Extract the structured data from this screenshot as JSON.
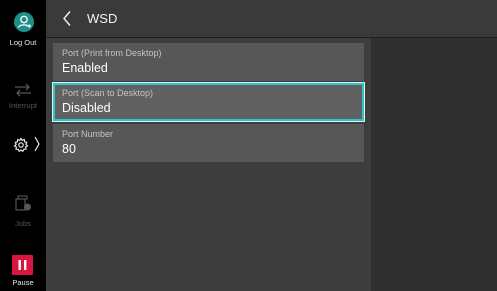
{
  "sidebar": {
    "logout": {
      "label": "Log Out",
      "icon": "user-logout-icon"
    },
    "interrupt": {
      "label": "Interrupt",
      "icon": "interrupt-icon"
    },
    "settings": {
      "icon": "gear-icon",
      "arrow": "〉"
    },
    "jobs": {
      "label": "Jobs",
      "icon": "jobs-icon"
    },
    "pause": {
      "label": "Pause",
      "icon": "pause-icon"
    }
  },
  "header": {
    "title": "WSD",
    "back_icon": "chevron-left-icon"
  },
  "settings": [
    {
      "label": "Port (Print from Desktop)",
      "value": "Enabled"
    },
    {
      "label": "Port (Scan to Desktop)",
      "value": "Disabled"
    },
    {
      "label": "Port Number",
      "value": "80"
    }
  ],
  "colors": {
    "accent": "#35c4c3",
    "logout_circle": "#1e8f87",
    "pause": "#d8163f",
    "background": "#2f2f2f",
    "row": "#575757"
  }
}
